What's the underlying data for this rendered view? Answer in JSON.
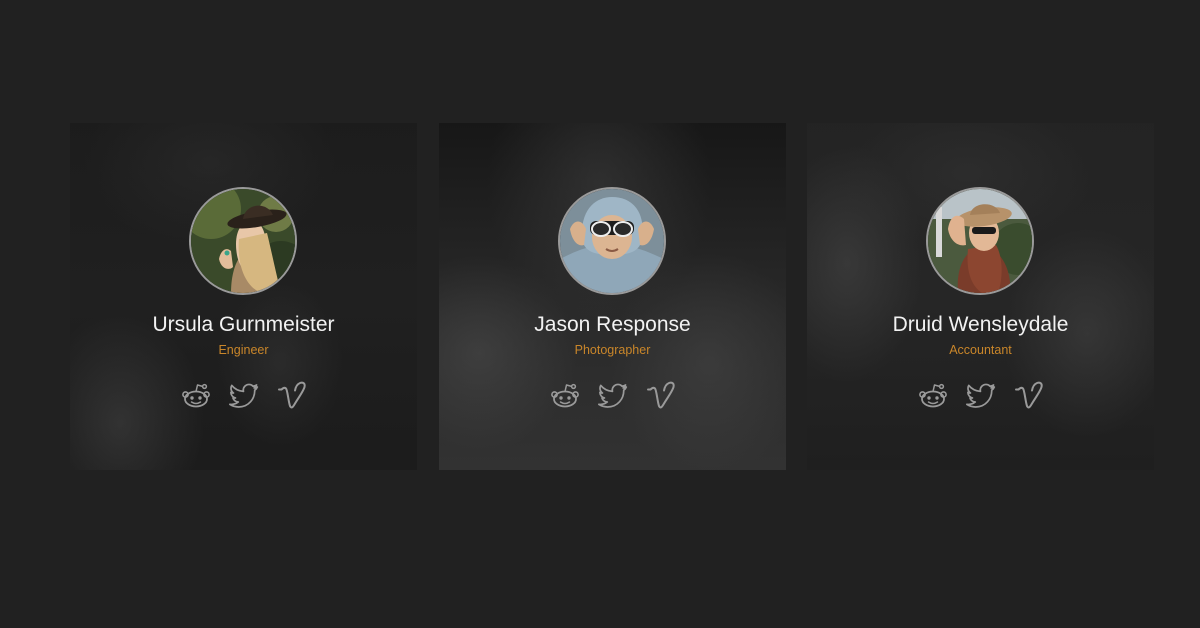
{
  "profiles": [
    {
      "name": "Ursula Gurnmeister",
      "role": "Engineer",
      "socials": [
        "reddit-icon",
        "twitter-icon",
        "vimeo-icon"
      ]
    },
    {
      "name": "Jason Response",
      "role": "Photographer",
      "socials": [
        "reddit-icon",
        "twitter-icon",
        "vimeo-icon"
      ]
    },
    {
      "name": "Druid Wensleydale",
      "role": "Accountant",
      "socials": [
        "reddit-icon",
        "twitter-icon",
        "vimeo-icon"
      ]
    }
  ],
  "colors": {
    "background": "#212121",
    "name_text": "#f2f2f2",
    "role_text": "#c9862a",
    "icon_stroke": "#9a9a9a",
    "avatar_border": "#9a9a9a"
  }
}
